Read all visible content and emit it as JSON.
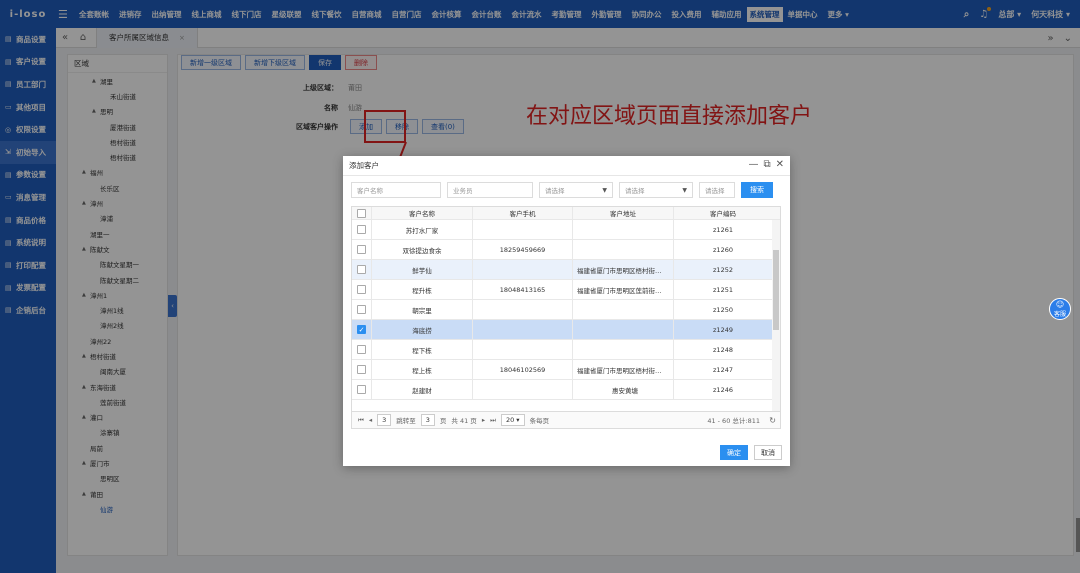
{
  "header": {
    "logo": "i-loso",
    "menu": [
      "全套账帐",
      "进销存",
      "出纳管理",
      "线上商城",
      "线下门店",
      "星级联盟",
      "线下餐饮",
      "自营商城",
      "自营门店",
      "会计核算",
      "会计台账",
      "会计流水",
      "考勤管理",
      "外勤管理",
      "协同办公",
      "投入费用",
      "辅助应用",
      "系统管理",
      "单据中心",
      "更多 ▾"
    ],
    "active_menu": "系统管理",
    "user": "总部 ▾",
    "company": "何天科技 ▾"
  },
  "sidebar": {
    "items": [
      "商品设置",
      "客户设置",
      "员工部门",
      "其他项目",
      "权限设置",
      "初始导入",
      "参数设置",
      "消息管理",
      "商品价格",
      "系统说明",
      "打印配置",
      "发票配置",
      "企销后台"
    ],
    "active": "初始导入"
  },
  "tabs": {
    "current": "客户所属区域信息"
  },
  "tree": {
    "title": "区域",
    "nodes": [
      {
        "label": "湖里",
        "level": 1,
        "arrow": true
      },
      {
        "label": "禾山街道",
        "level": 2
      },
      {
        "label": "思明",
        "level": 1,
        "arrow": true
      },
      {
        "label": "厦港街道",
        "level": 2
      },
      {
        "label": "梧村街道",
        "level": 2
      },
      {
        "label": "梧村街道",
        "level": 2
      },
      {
        "label": "福州",
        "level": 0,
        "arrow": true
      },
      {
        "label": "长乐区",
        "level": 1
      },
      {
        "label": "漳州",
        "level": 0,
        "arrow": true
      },
      {
        "label": "漳浦",
        "level": 1
      },
      {
        "label": "湖里一",
        "level": 0
      },
      {
        "label": "陈献文",
        "level": 0,
        "arrow": true
      },
      {
        "label": "陈献文星期一",
        "level": 1
      },
      {
        "label": "陈献文星期二",
        "level": 1
      },
      {
        "label": "漳州1",
        "level": 0,
        "arrow": true
      },
      {
        "label": "漳州1线",
        "level": 1
      },
      {
        "label": "漳州2线",
        "level": 1
      },
      {
        "label": "漳州22",
        "level": 0
      },
      {
        "label": "梧村街道",
        "level": 0,
        "arrow": true
      },
      {
        "label": "闽南大厦",
        "level": 1
      },
      {
        "label": "东海街道",
        "level": 0,
        "arrow": true
      },
      {
        "label": "莲前街道",
        "level": 1
      },
      {
        "label": "灌口",
        "level": 0,
        "arrow": true
      },
      {
        "label": "涂寨镇",
        "level": 1
      },
      {
        "label": "局前",
        "level": 0
      },
      {
        "label": "厦门市",
        "level": 0,
        "arrow": true
      },
      {
        "label": "思明区",
        "level": 1
      },
      {
        "label": "莆田",
        "level": 0,
        "arrow": true
      },
      {
        "label": "仙游",
        "level": 1,
        "selected": true
      }
    ]
  },
  "panel": {
    "buttons": {
      "add_l1": "新增一级区域",
      "add_sub": "新增下级区域",
      "save": "保存",
      "delete": "删除"
    },
    "parent_label": "上级区域：",
    "parent_value": "莆田",
    "name_label": "名称",
    "name_value": "仙游",
    "op_label": "区域客户操作",
    "op_add": "添加",
    "op_remove": "移除",
    "op_view": "查看(0)"
  },
  "annotation": "在对应区域页面直接添加客户",
  "modal": {
    "title": "添加客户",
    "filters": {
      "name_ph": "客户名称",
      "staff_ph": "业务员",
      "select1": "请选择",
      "select2": "请选择",
      "select3": "请选择",
      "search": "搜索"
    },
    "columns": [
      "客户名称",
      "客户手机",
      "客户地址",
      "客户编码"
    ],
    "rows": [
      {
        "name": "苏打水厂家",
        "phone": "",
        "addr": "",
        "code": "z1261",
        "checked": false
      },
      {
        "name": "双徐提边食余",
        "phone": "18259459669",
        "addr": "",
        "code": "z1260",
        "checked": false
      },
      {
        "name": "鲜芋仙",
        "phone": "",
        "addr": "福建省厦门市思明区梧村街…",
        "code": "z1252",
        "checked": false
      },
      {
        "name": "程升栋",
        "phone": "18048413165",
        "addr": "福建省厦门市思明区莲前街…",
        "code": "z1251",
        "checked": false
      },
      {
        "name": "朝宗里",
        "phone": "",
        "addr": "",
        "code": "z1250",
        "checked": false
      },
      {
        "name": "海底捞",
        "phone": "",
        "addr": "",
        "code": "z1249",
        "checked": true
      },
      {
        "name": "程下栋",
        "phone": "",
        "addr": "",
        "code": "z1248",
        "checked": false
      },
      {
        "name": "程上栋",
        "phone": "18046102569",
        "addr": "福建省厦门市思明区梧村街…",
        "code": "z1247",
        "checked": false
      },
      {
        "name": "赵建财",
        "phone": "",
        "addr": "惠安黄塘",
        "code": "z1246",
        "checked": false
      }
    ],
    "pager": {
      "page": "3",
      "goto_label": "跳转至",
      "goto_val": "3",
      "page_unit": "页",
      "total_pages": "共 41 页",
      "page_size": "20",
      "per_page": "条每页",
      "summary": "41 - 60 总计:811"
    },
    "ok": "确定",
    "cancel": "取消"
  },
  "service": "客服"
}
